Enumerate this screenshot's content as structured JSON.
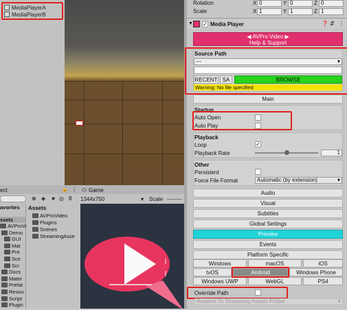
{
  "hierarchy": {
    "items": [
      "MediaPlayerA",
      "MediaPlayerB"
    ]
  },
  "transform": {
    "rotation_label": "Rotation",
    "scale_label": "Scale",
    "rotation": {
      "x": "0",
      "y": "0",
      "z": "0"
    },
    "scale": {
      "x": "1",
      "y": "1",
      "z": "1"
    },
    "axis": {
      "x": "X",
      "y": "Y",
      "z": "Z"
    }
  },
  "component": {
    "title": "Media Player",
    "checked": "✓"
  },
  "banner": {
    "line1": "◀ AVPro Video ▶",
    "line2": "Help & Support"
  },
  "source": {
    "header": "Source Path",
    "dropdown": "---",
    "recent": "RECENT",
    "sa": "SA",
    "browse": "BROWSE",
    "warning": "Warning: No file specified"
  },
  "sections": {
    "main": "Main",
    "audio": "Audio",
    "visual": "Visual",
    "subtitles": "Subtitles",
    "global": "Global Settings",
    "preview": "Preview",
    "events": "Events",
    "platform": "Platform Specific"
  },
  "startup": {
    "header": "Startup",
    "auto_open": "Auto Open",
    "auto_play": "Auto Play"
  },
  "playback": {
    "header": "Playback",
    "loop": "Loop",
    "rate": "Playback Rate",
    "rate_value": "1",
    "loop_check": "✓",
    "rate_fraction": 0.5
  },
  "other": {
    "header": "Other",
    "persistent": "Persistent",
    "format": "Force File Format",
    "format_value": "Automatic (by extension)"
  },
  "platforms": [
    "Windows",
    "macOS",
    "iOS",
    "tvOS",
    "Android",
    "Windows Phone",
    "Windows UWP",
    "WebGL",
    "PS4"
  ],
  "override": {
    "label": "Override Path",
    "sub": "Relative To Streaming Assets Folder"
  },
  "project": {
    "tab": "ect",
    "favorites": "avorites",
    "assets_root": "ssets",
    "assets_header": "Assets",
    "filter_count": "8",
    "tree": [
      "AVProVi",
      "Demo",
      "GUI",
      "Mat",
      "Pre",
      "Sce",
      "Scr",
      "Docs",
      "Mater",
      "Prefat",
      "Resou",
      "Script",
      "Plugin"
    ],
    "folders": [
      "AVProVideo",
      "Plugins",
      "Scenes",
      "StreamingAsse"
    ]
  },
  "game": {
    "tab": "Game",
    "resolution": "1344x750",
    "scale_label": "Scale"
  },
  "colors": {
    "banner": "#e0306d",
    "browse": "#27d31c",
    "warning": "#f3e200",
    "preview": "#1fd3d8",
    "highlight": "#e0211b"
  }
}
